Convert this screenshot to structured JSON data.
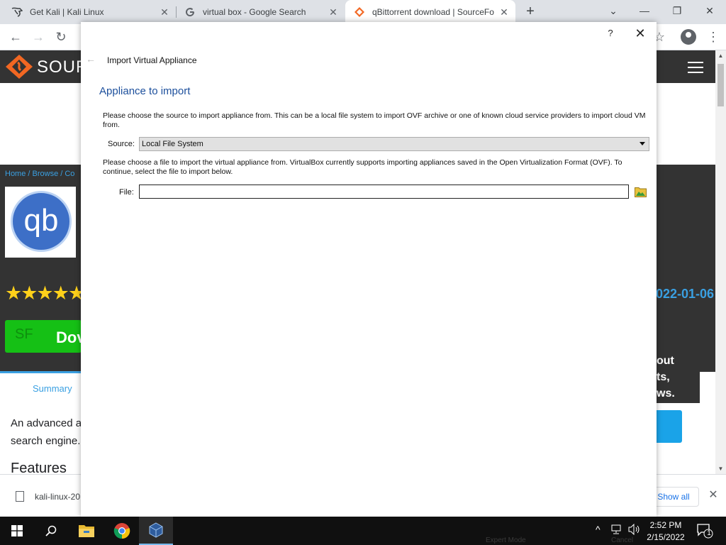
{
  "browser": {
    "tabs": [
      {
        "title": "Get Kali | Kali Linux",
        "favicon": "kali-dragon-icon"
      },
      {
        "title": "virtual box - Google Search",
        "favicon": "google-g-icon"
      },
      {
        "title": "qBittorrent download | SourceFo",
        "favicon": "sourceforge-icon"
      }
    ],
    "new_tab_symbol": "+",
    "close_symbol": "✕",
    "window_controls": {
      "minimize": "—",
      "restore": "❐",
      "close": "✕"
    }
  },
  "background_page": {
    "site_logo_text": "SOUR",
    "breadcrumb": "Home / Browse / Co",
    "app_logo_text": "qb",
    "stars": "★★★★★",
    "date_text": "022-01-06",
    "download_button": "Dov",
    "download_button_badge": "SF",
    "summary_tab": "Summary",
    "description_lines": [
      "An advanced a",
      "search engine."
    ],
    "features_heading": "Features",
    "side_card_text": [
      "out",
      "ts,",
      "ws."
    ]
  },
  "download_bar": {
    "filename": "kali-linux-20",
    "show_all": "Show all"
  },
  "dialog": {
    "help_symbol": "?",
    "close_symbol": "✕",
    "back_symbol": "←",
    "title": "Import Virtual Appliance",
    "heading": "Appliance to import",
    "intro_text": "Please choose the source to import appliance from. This can be a local file system to import OVF archive or one of known cloud service providers to import cloud VM from.",
    "source_label": "Source:",
    "source_value": "Local File System",
    "file_instructions": "Please choose a file to import the virtual appliance from. VirtualBox currently supports importing appliances saved in the Open Virtualization Format (OVF). To continue, select the file to import below.",
    "file_label": "File:",
    "file_value": ""
  },
  "taskbar": {
    "ghost_left": "Expert Mode",
    "ghost_right": "Cancel",
    "time": "2:52 PM",
    "date": "2/15/2022",
    "notification_count": "1"
  },
  "colors": {
    "dialog_heading": "#1c4f9c",
    "sf_dark": "#333333",
    "sf_accent": "#3aa0e2",
    "download_green": "#15c015"
  }
}
